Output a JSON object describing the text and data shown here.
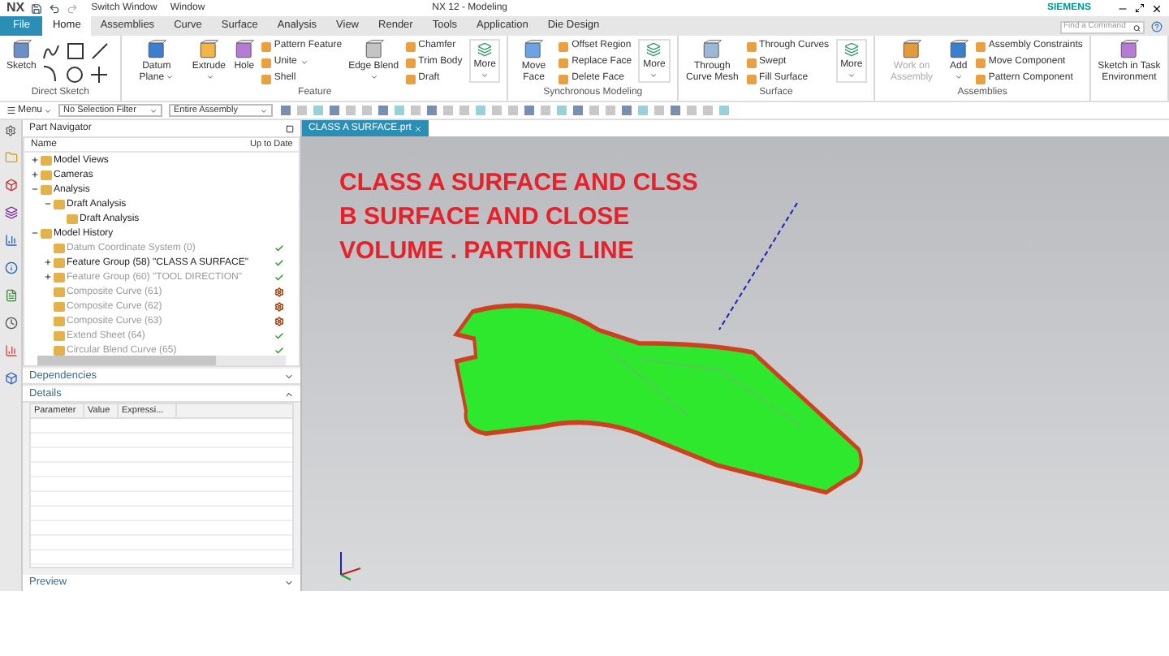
{
  "title_bar": {
    "app": "NX",
    "quick_access": [
      "Switch Window",
      "Window"
    ],
    "title": "NX 12 - Modeling",
    "brand": "SIEMENS"
  },
  "menu_tabs": [
    {
      "label": "File",
      "selected": false,
      "kind": "file"
    },
    {
      "label": "Home",
      "selected": true,
      "kind": "tab"
    },
    {
      "label": "Assemblies",
      "selected": false,
      "kind": "tab"
    },
    {
      "label": "Curve",
      "selected": false,
      "kind": "tab"
    },
    {
      "label": "Surface",
      "selected": false,
      "kind": "tab"
    },
    {
      "label": "Analysis",
      "selected": false,
      "kind": "tab"
    },
    {
      "label": "View",
      "selected": false,
      "kind": "tab"
    },
    {
      "label": "Render",
      "selected": false,
      "kind": "tab"
    },
    {
      "label": "Tools",
      "selected": false,
      "kind": "tab"
    },
    {
      "label": "Application",
      "selected": false,
      "kind": "tab"
    },
    {
      "label": "Die Design",
      "selected": false,
      "kind": "tab"
    }
  ],
  "search": {
    "placeholder": "Find a Command"
  },
  "ribbon_groups": [
    {
      "title": "Direct Sketch",
      "columns": [
        {
          "kind": "large",
          "label": "Sketch",
          "dropdown": false,
          "disabled": false
        },
        {
          "kind": "sketch_tools"
        }
      ]
    },
    {
      "title": "Feature",
      "columns": [
        {
          "kind": "large",
          "label": "Datum Plane",
          "dropdown": true,
          "disabled": false
        },
        {
          "kind": "large",
          "label": "Extrude",
          "dropdown": true,
          "disabled": false
        },
        {
          "kind": "large",
          "label": "Hole",
          "dropdown": false,
          "disabled": false
        },
        {
          "kind": "stack",
          "items": [
            {
              "label": "Pattern Feature",
              "dropdown": false,
              "disabled": false
            },
            {
              "label": "Unite",
              "dropdown": true,
              "disabled": false
            },
            {
              "label": "Shell",
              "dropdown": false,
              "disabled": false
            }
          ]
        },
        {
          "kind": "large",
          "label": "Edge Blend",
          "dropdown": true,
          "disabled": false
        },
        {
          "kind": "stack",
          "items": [
            {
              "label": "Chamfer",
              "dropdown": false,
              "disabled": false
            },
            {
              "label": "Trim Body",
              "dropdown": false,
              "disabled": false
            },
            {
              "label": "Draft",
              "dropdown": false,
              "disabled": false
            }
          ]
        },
        {
          "kind": "more",
          "label": "More"
        }
      ]
    },
    {
      "title": "Synchronous Modeling",
      "columns": [
        {
          "kind": "large",
          "label": "Move Face",
          "dropdown": false,
          "disabled": false
        },
        {
          "kind": "stack",
          "items": [
            {
              "label": "Offset Region",
              "dropdown": false,
              "disabled": false
            },
            {
              "label": "Replace Face",
              "dropdown": false,
              "disabled": false
            },
            {
              "label": "Delete Face",
              "dropdown": false,
              "disabled": false
            }
          ]
        },
        {
          "kind": "more",
          "label": "More"
        }
      ]
    },
    {
      "title": "Surface",
      "columns": [
        {
          "kind": "large",
          "label": "Through Curve Mesh",
          "dropdown": false,
          "disabled": false
        },
        {
          "kind": "stack",
          "items": [
            {
              "label": "Through Curves",
              "dropdown": false,
              "disabled": false
            },
            {
              "label": "Swept",
              "dropdown": false,
              "disabled": false
            },
            {
              "label": "Fill Surface",
              "dropdown": false,
              "disabled": false
            }
          ]
        },
        {
          "kind": "more",
          "label": "More"
        }
      ]
    },
    {
      "title": "Assemblies",
      "columns": [
        {
          "kind": "large",
          "label": "Work on Assembly",
          "dropdown": false,
          "disabled": true
        },
        {
          "kind": "large",
          "label": "Add",
          "dropdown": true,
          "disabled": false
        },
        {
          "kind": "stack",
          "items": [
            {
              "label": "Assembly Constraints",
              "dropdown": false,
              "disabled": false
            },
            {
              "label": "Move Component",
              "dropdown": false,
              "disabled": false
            },
            {
              "label": "Pattern Component",
              "dropdown": false,
              "disabled": false
            }
          ]
        }
      ]
    },
    {
      "columns": [
        {
          "kind": "large",
          "label": "Sketch in Task Environment",
          "dropdown": false,
          "disabled": false
        }
      ]
    }
  ],
  "command_bar": {
    "menu": "Menu",
    "selection_filter": "No Selection Filter",
    "scope": "Entire Assembly"
  },
  "part_navigator": {
    "title": "Part Navigator",
    "columns": [
      "Name",
      "Up to Date"
    ],
    "tree": [
      {
        "label": "Model Views",
        "expanded": false,
        "dimmed": false
      },
      {
        "label": "Cameras",
        "expanded": false,
        "dimmed": false
      },
      {
        "label": "Analysis",
        "expanded": true,
        "dimmed": false,
        "children": [
          {
            "label": "Draft Analysis",
            "expanded": true,
            "dimmed": false,
            "children": [
              {
                "label": "Draft Analysis",
                "dimmed": false
              }
            ]
          }
        ]
      },
      {
        "label": "Model History",
        "expanded": true,
        "dimmed": false,
        "children": [
          {
            "label": "Datum Coordinate System (0)",
            "dimmed": true,
            "up_to_date": true
          },
          {
            "label": "Feature Group (58) \"CLASS A SURFACE\"",
            "dimmed": false,
            "up_to_date": true,
            "expanded": false
          },
          {
            "label": "Feature Group (60) \"TOOL DIRECTION\"",
            "dimmed": true,
            "up_to_date": true,
            "expanded": false
          },
          {
            "label": "Composite Curve (61)",
            "dimmed": true,
            "up_to_date": false
          },
          {
            "label": "Composite Curve (62)",
            "dimmed": true,
            "up_to_date": false
          },
          {
            "label": "Composite Curve (63)",
            "dimmed": true,
            "up_to_date": false
          },
          {
            "label": "Extend Sheet (64)",
            "dimmed": true,
            "up_to_date": true
          },
          {
            "label": "Circular Blend Curve (65)",
            "dimmed": true,
            "up_to_date": true
          }
        ]
      }
    ]
  },
  "panels": [
    {
      "title": "Dependencies",
      "expanded": false
    },
    {
      "title": "Details",
      "expanded": true
    }
  ],
  "details_table": {
    "columns": [
      "Parameter",
      "Value",
      "Expressi..."
    ]
  },
  "preview": {
    "title": "Preview",
    "expanded": false
  },
  "document_tab": {
    "label": "CLASS A SURFACE.prt"
  },
  "annotation": [
    "CLASS A SURFACE AND CLSS",
    "B SURFACE AND CLOSE",
    "VOLUME . PARTING LINE"
  ]
}
